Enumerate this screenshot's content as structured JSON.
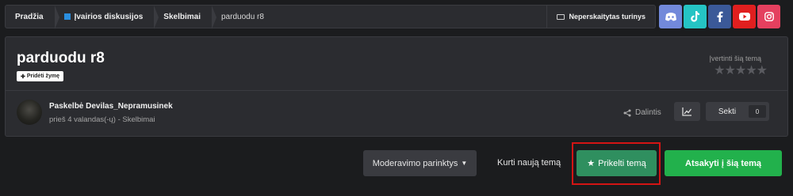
{
  "breadcrumb": {
    "items": [
      {
        "label": "Pradžia"
      },
      {
        "label": "Įvairios diskusijos"
      },
      {
        "label": "Skelbimai"
      },
      {
        "label": "parduodu r8"
      }
    ],
    "unread_label": "Neperskaitytas turinys"
  },
  "social": [
    {
      "icon": "discord-icon",
      "color": "#7289da"
    },
    {
      "icon": "tiktok-icon",
      "color": "#25c4c4"
    },
    {
      "icon": "facebook-icon",
      "color": "#3b5998"
    },
    {
      "icon": "youtube-icon",
      "color": "#e01f1f"
    },
    {
      "icon": "instagram-icon",
      "color": "#e4405f"
    }
  ],
  "topic": {
    "title": "parduodu r8",
    "add_tag_label": "Pridėti žymę",
    "rate_label": "Įvertinti šią temą",
    "stars": "★★★★★",
    "author_line": "Paskelbė Devilas_Nepramusinek",
    "meta_line": "prieš 4 valandas(-ų) - Skelbimai",
    "share_label": "Dalintis",
    "follow_label": "Sekti",
    "follow_count": "0"
  },
  "actions": {
    "moderation_label": "Moderavimo parinktys",
    "new_topic_label": "Kurti naują temą",
    "bump_label": "Prikelti temą",
    "reply_label": "Atsakyti į šią temą"
  },
  "colors": {
    "bump": "#2f8f5f",
    "reply": "#22b14c",
    "highlight": "#d41414"
  }
}
